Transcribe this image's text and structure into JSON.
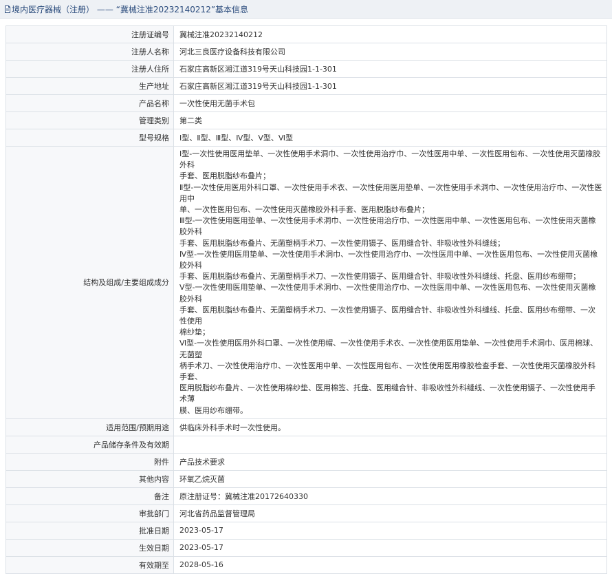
{
  "header": {
    "title": "境内医疗器械（注册） —— “冀械注准20232140212”基本信息",
    "icon": "document-icon"
  },
  "rows": [
    {
      "label": "注册证编号",
      "value": "冀械注准20232140212"
    },
    {
      "label": "注册人名称",
      "value": "河北三良医疗设备科技有限公司"
    },
    {
      "label": "注册人住所",
      "value": "石家庄高新区湘江道319号天山科技园1-1-301"
    },
    {
      "label": "生产地址",
      "value": "石家庄高新区湘江道319号天山科技园1-1-301"
    },
    {
      "label": "产品名称",
      "value": "一次性使用无菌手术包"
    },
    {
      "label": "管理类别",
      "value": "第二类"
    },
    {
      "label": "型号规格",
      "value": "Ⅰ型、Ⅱ型、Ⅲ型、Ⅳ型、Ⅴ型、Ⅵ型"
    }
  ],
  "composition": {
    "label": "结构及组成/主要组成成分",
    "lines": [
      "Ⅰ型-一次性使用医用垫单、一次性使用手术洞巾、一次性使用治疗巾、一次性医用中单、一次性医用包布、一次性使用灭菌橡胶外科",
      "手套、医用脱脂纱布叠片；",
      "Ⅱ型-一次性使用医用外科口罩、一次性使用手术衣、一次性使用医用垫单、一次性使用手术洞巾、一次性使用治疗巾、一次性医用中",
      "单、一次性医用包布、一次性使用灭菌橡胶外科手套、医用脱脂纱布叠片；",
      "Ⅲ型-一次性使用医用垫单、一次性使用手术洞巾、一次性使用治疗巾、一次性医用中单、一次性医用包布、一次性使用灭菌橡胶外科",
      "手套、医用脱脂纱布叠片、无菌塑柄手术刀、一次性使用镊子、医用缝合针、非吸收性外科缝线；",
      "Ⅳ型-一次性使用医用垫单、一次性使用手术洞巾、一次性使用治疗巾、一次性医用中单、一次性医用包布、一次性使用灭菌橡胶外科",
      "手套、医用脱脂纱布叠片、无菌塑柄手术刀、一次性使用镊子、医用缝合针、非吸收性外科缝线、托盘、医用纱布绷带；",
      "Ⅴ型-一次性使用医用垫单、一次性使用手术洞巾、一次性使用治疗巾、一次性医用中单、一次性医用包布、一次性使用灭菌橡胶外科",
      "手套、医用脱脂纱布叠片、无菌塑柄手术刀、一次性使用镊子、医用缝合针、非吸收性外科缝线、托盘、医用纱布绷带、一次性使用",
      "棉纱垫；",
      "Ⅵ型-一次性使用医用外科口罩、一次性使用帽、一次性使用手术衣、一次性使用医用垫单、一次性使用手术洞巾、医用棉球、无菌塑",
      "柄手术刀、一次性使用治疗巾、一次性医用中单、一次性医用包布、一次性使用医用橡胶检查手套、一次性使用灭菌橡胶外科手套、",
      "医用脱脂纱布叠片、一次性使用棉纱垫、医用棉签、托盘、医用缝合针、非吸收性外科缝线、一次性使用镊子、一次性使用手术薄",
      "膜、医用纱布绷带。"
    ]
  },
  "rows2": [
    {
      "label": "适用范围/预期用途",
      "value": "供临床外科手术时一次性使用。"
    },
    {
      "label": "产品储存条件及有效期",
      "value": ""
    },
    {
      "label": "附件",
      "value": "产品技术要求"
    },
    {
      "label": "其他内容",
      "value": "环氧乙烷灭菌"
    },
    {
      "label": "备注",
      "value": "原注册证号：冀械注准20172640330"
    },
    {
      "label": "审批部门",
      "value": "河北省药品监督管理局"
    },
    {
      "label": "批准日期",
      "value": "2023-05-17"
    },
    {
      "label": "生效日期",
      "value": "2023-05-17"
    },
    {
      "label": "有效期至",
      "value": "2028-05-16"
    }
  ],
  "colors": {
    "header_bg": "#eef1f5",
    "header_text": "#2a4b7c",
    "border": "#dbe0e6",
    "label_bg": "#f7f8fa"
  }
}
